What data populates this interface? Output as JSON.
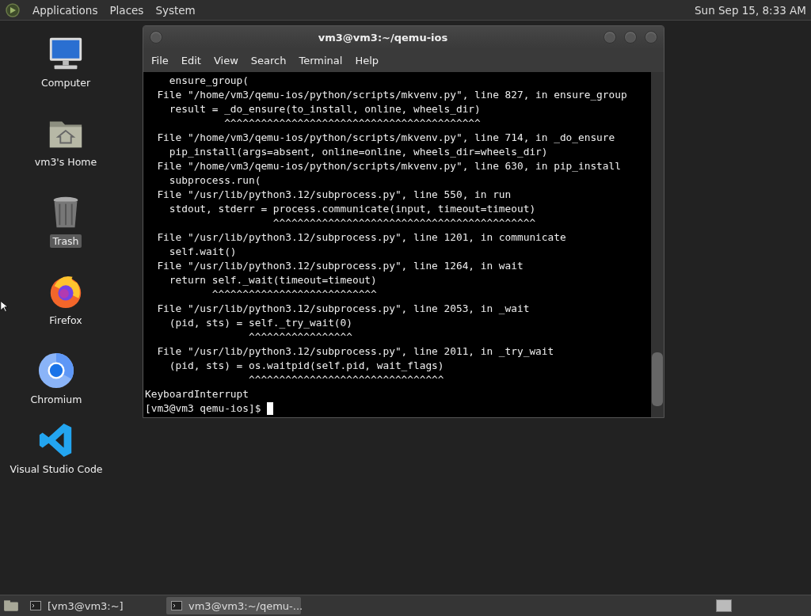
{
  "top_panel": {
    "menus": [
      "Applications",
      "Places",
      "System"
    ],
    "clock": "Sun Sep 15, 8:33 AM"
  },
  "desktop_icons": [
    {
      "label": "Computer",
      "kind": "computer",
      "selected": false
    },
    {
      "label": "vm3's Home",
      "kind": "home",
      "selected": false
    },
    {
      "label": "Trash",
      "kind": "trash",
      "selected": true
    },
    {
      "label": "Firefox",
      "kind": "firefox",
      "selected": false
    },
    {
      "label": "Chromium",
      "kind": "chromium",
      "selected": false
    },
    {
      "label": "Visual Studio Code",
      "kind": "vscode",
      "selected": false
    }
  ],
  "terminal": {
    "title": "vm3@vm3:~/qemu-ios",
    "menu": [
      "File",
      "Edit",
      "View",
      "Search",
      "Terminal",
      "Help"
    ],
    "lines": [
      "    ensure_group(",
      "  File \"/home/vm3/qemu-ios/python/scripts/mkvenv.py\", line 827, in ensure_group",
      "    result = _do_ensure(to_install, online, wheels_dir)",
      "             ^^^^^^^^^^^^^^^^^^^^^^^^^^^^^^^^^^^^^^^^^^",
      "  File \"/home/vm3/qemu-ios/python/scripts/mkvenv.py\", line 714, in _do_ensure",
      "    pip_install(args=absent, online=online, wheels_dir=wheels_dir)",
      "  File \"/home/vm3/qemu-ios/python/scripts/mkvenv.py\", line 630, in pip_install",
      "    subprocess.run(",
      "  File \"/usr/lib/python3.12/subprocess.py\", line 550, in run",
      "    stdout, stderr = process.communicate(input, timeout=timeout)",
      "                     ^^^^^^^^^^^^^^^^^^^^^^^^^^^^^^^^^^^^^^^^^^^",
      "  File \"/usr/lib/python3.12/subprocess.py\", line 1201, in communicate",
      "    self.wait()",
      "  File \"/usr/lib/python3.12/subprocess.py\", line 1264, in wait",
      "    return self._wait(timeout=timeout)",
      "           ^^^^^^^^^^^^^^^^^^^^^^^^^^^",
      "  File \"/usr/lib/python3.12/subprocess.py\", line 2053, in _wait",
      "    (pid, sts) = self._try_wait(0)",
      "                 ^^^^^^^^^^^^^^^^^",
      "  File \"/usr/lib/python3.12/subprocess.py\", line 2011, in _try_wait",
      "    (pid, sts) = os.waitpid(self.pid, wait_flags)",
      "                 ^^^^^^^^^^^^^^^^^^^^^^^^^^^^^^^^",
      "KeyboardInterrupt"
    ],
    "prompt": "[vm3@vm3 qemu-ios]$"
  },
  "taskbar": {
    "tasks": [
      {
        "label": "[vm3@vm3:~]",
        "selected": false
      },
      {
        "label": "vm3@vm3:~/qemu-...",
        "selected": true
      }
    ]
  }
}
